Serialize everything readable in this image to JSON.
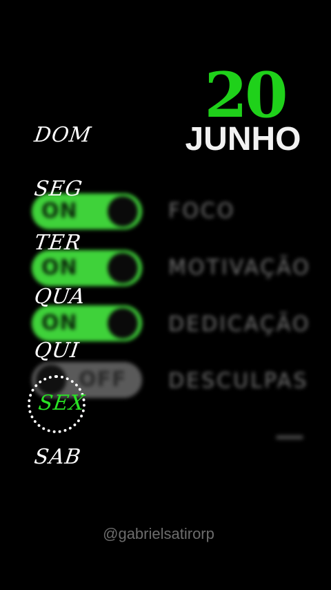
{
  "date": {
    "day": "20",
    "month": "JUNHO"
  },
  "weekdays": [
    "DOM",
    "SEG",
    "TER",
    "QUA",
    "QUI",
    "SEX",
    "SAB"
  ],
  "active_day": "SEX",
  "toggles": [
    {
      "state": "ON",
      "label": "FOCO"
    },
    {
      "state": "ON",
      "label": "MOTIVAÇÃO"
    },
    {
      "state": "ON",
      "label": "DEDICAÇÃO"
    },
    {
      "state": "OFF",
      "label": "DESCULPAS"
    }
  ],
  "handle": "@gabrielsatirorp",
  "colors": {
    "accent": "#29e224",
    "background": "#000000",
    "text": "#ffffff"
  }
}
